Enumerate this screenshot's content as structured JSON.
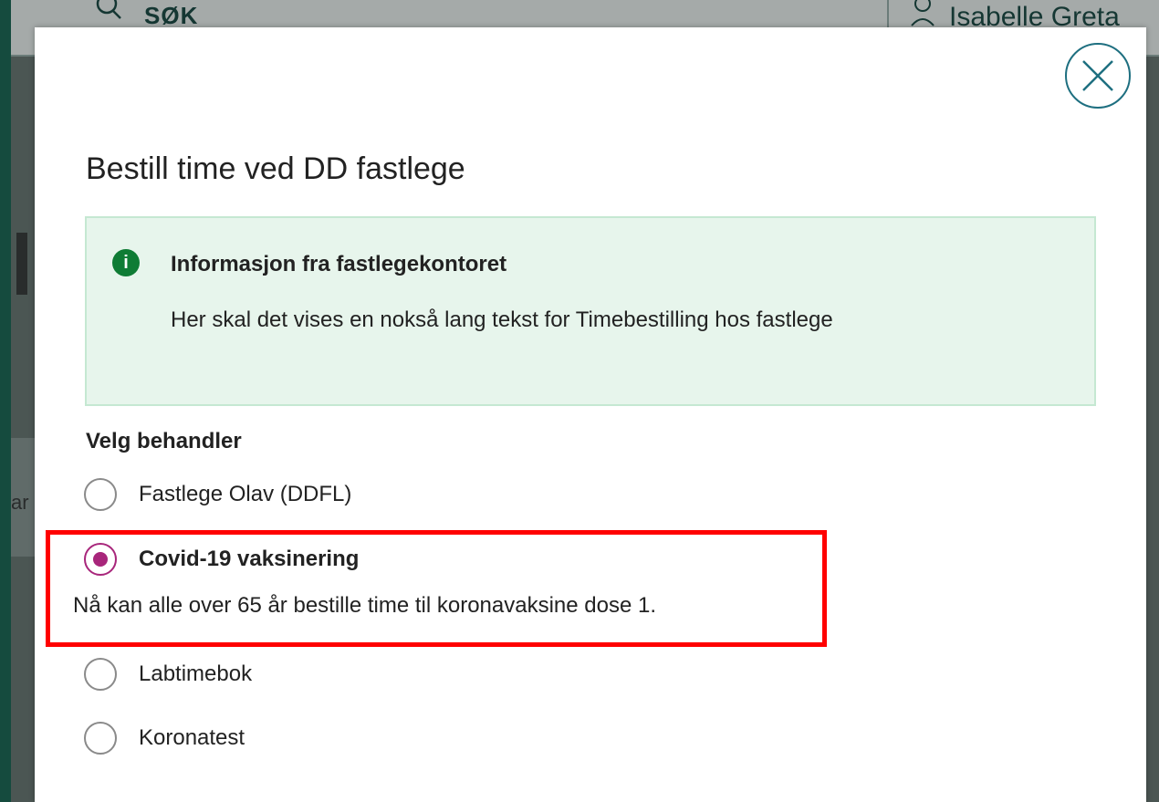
{
  "background": {
    "search_label": "SØK",
    "user_name": "Isabelle Greta",
    "partial_text": "ar"
  },
  "modal": {
    "title": "Bestill time ved DD fastlege",
    "close_icon": "close-icon",
    "info_box": {
      "icon": "info-icon",
      "icon_glyph": "i",
      "title": "Informasjon fra fastlegekontoret",
      "text": "Her skal det vises en nokså lang tekst for Timebestilling hos fastlege"
    },
    "section_label": "Velg behandler",
    "options": [
      {
        "label": "Fastlege Olav (DDFL)",
        "selected": false
      },
      {
        "label": "Covid-19 vaksinering",
        "selected": true,
        "description": "Nå kan alle over 65 år bestille time til koronavaksine dose 1."
      },
      {
        "label": "Labtimebok",
        "selected": false
      },
      {
        "label": "Koronatest",
        "selected": false
      }
    ]
  },
  "colors": {
    "accent": "#a8267b",
    "info_bg": "#e7f5ec",
    "info_icon": "#0f7c35",
    "close_ring": "#1e6f80",
    "highlight": "#ff0000",
    "frame": "#0b5a46"
  }
}
